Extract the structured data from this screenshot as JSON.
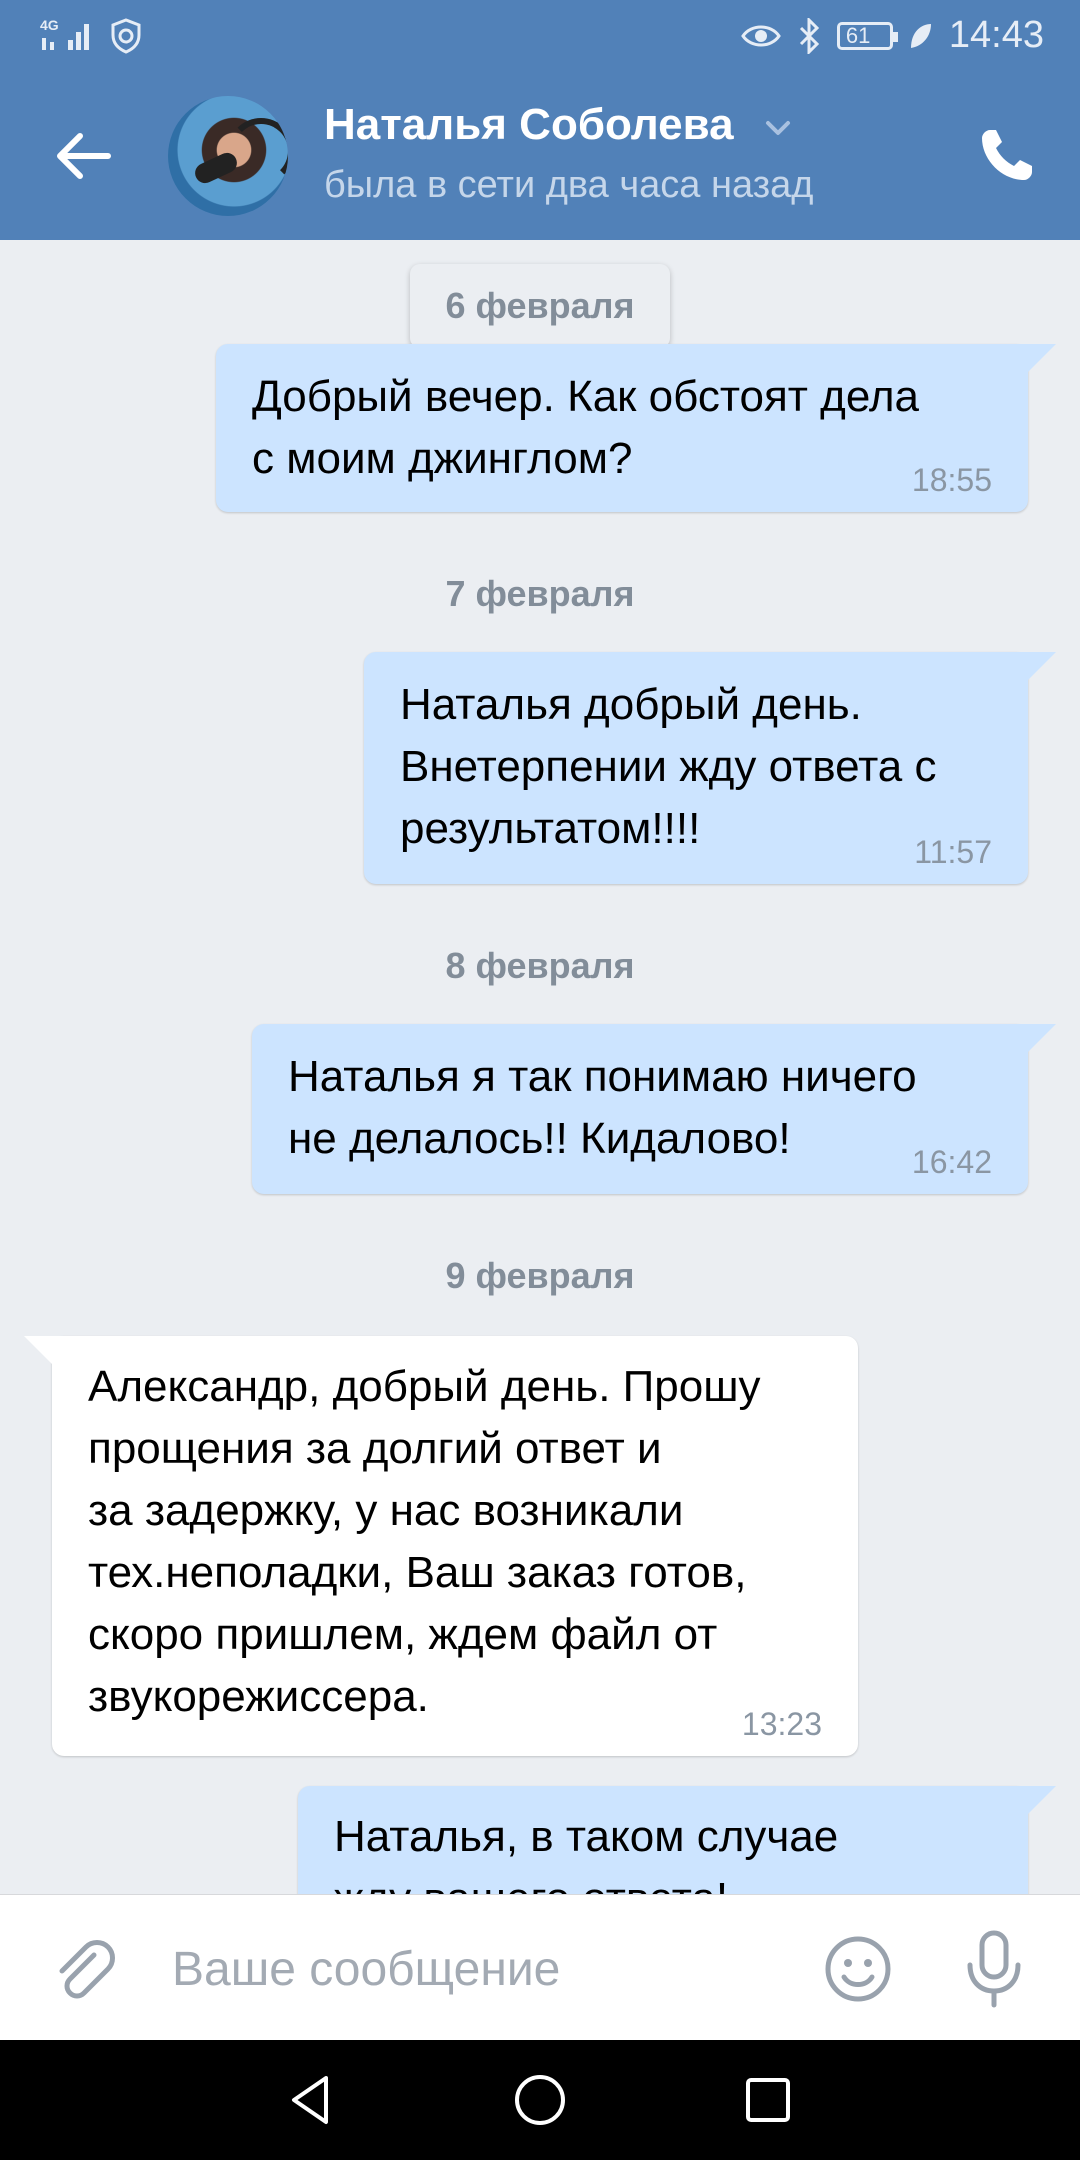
{
  "status_bar": {
    "network": "4G",
    "battery": "61",
    "time": "14:43"
  },
  "header": {
    "contact_name": "Наталья Соболева",
    "last_seen": "была в сети два часа назад"
  },
  "messages": [
    {
      "kind": "date",
      "text": "6 февраля"
    },
    {
      "kind": "out",
      "text": "Добрый вечер. Как обстоят дела\nс моим джинглом?",
      "time": "18:55"
    },
    {
      "kind": "date",
      "text": "7 февраля"
    },
    {
      "kind": "out",
      "text": "Наталья добрый день.\nВнетерпении жду ответа с\nрезультатом!!!!",
      "time": "11:57"
    },
    {
      "kind": "date",
      "text": "8 февраля"
    },
    {
      "kind": "out",
      "text": "Наталья я так понимаю ничего\nне делалось!! Кидалово!",
      "time": "16:42"
    },
    {
      "kind": "date",
      "text": "9 февраля"
    },
    {
      "kind": "in",
      "text": "Александр, добрый день. Прошу\nпрощения за долгий ответ и\nза задержку, у нас возникали\nтех.неполадки, Ваш заказ готов,\nскоро пришлем, ждем файл от\nзвукорежиссера.",
      "time": "13:23"
    },
    {
      "kind": "out",
      "text": "Наталья, в таком случае\nжду вашего ответа!",
      "time": ""
    }
  ],
  "input": {
    "placeholder": "Ваше сообщение"
  },
  "colors": {
    "header_bg": "#5181b8",
    "chat_bg": "#ebeef2",
    "outgoing_bubble": "#cce4ff",
    "incoming_bubble": "#ffffff"
  },
  "icons": {
    "back": "arrow-left-icon",
    "call": "phone-icon",
    "attach": "paperclip-icon",
    "emoji": "smiley-icon",
    "voice": "microphone-icon"
  }
}
